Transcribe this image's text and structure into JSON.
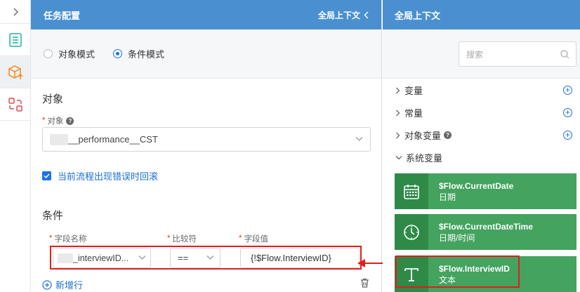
{
  "mid": {
    "header_title": "任务配置",
    "header_context": "全局上下文",
    "modes": [
      "对象模式",
      "条件模式"
    ],
    "object_section": "对象",
    "object_label": "对象",
    "object_value": "__performance__CST",
    "rollback_label": "当前流程出现错误时回滚",
    "condition_section": "条件",
    "col_field": "字段名称",
    "col_op": "比较符",
    "col_value": "字段值",
    "row_field": "_interviewID...",
    "row_op": "==",
    "row_value": "{!$Flow.InterviewID}",
    "add_row": "新增行"
  },
  "right": {
    "header_title": "全局上下文",
    "search_placeholder": "搜索",
    "tree": [
      "变量",
      "常量",
      "对象变量",
      "系统变量"
    ],
    "cards": [
      {
        "name": "$Flow.CurrentDate",
        "type": "日期",
        "icon": "calendar-icon"
      },
      {
        "name": "$Flow.CurrentDateTime",
        "type": "日期/时间",
        "icon": "clock-icon"
      },
      {
        "name": "$Flow.InterviewID",
        "type": "文本",
        "icon": "text-t-icon"
      }
    ]
  },
  "colors": {
    "header": "#4a90d0",
    "accent": "#1a73e8",
    "card": "#43a35f",
    "card_icon": "#2f8a48",
    "highlight": "#e01e1e"
  }
}
